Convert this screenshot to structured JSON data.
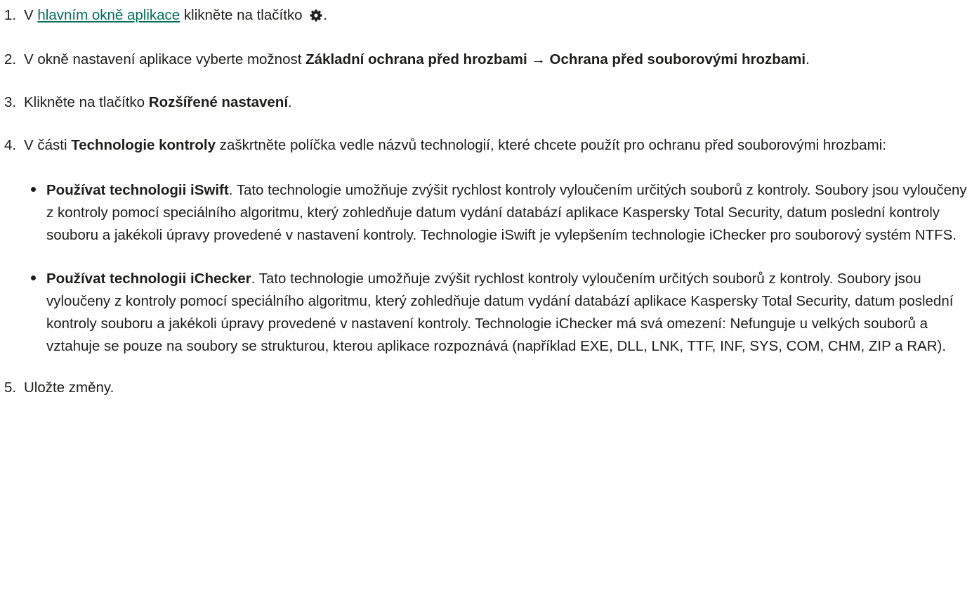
{
  "steps": [
    {
      "number": "1.",
      "prefix": "V ",
      "link": "hlavním okně aplikace",
      "middle": " klikněte na tlačítko ",
      "icon": "gear-icon",
      "suffix": "."
    },
    {
      "number": "2.",
      "text": "V okně nastavení aplikace vyberte možnost ",
      "bold": "Základní ochrana před hrozbami → Ochrana před souborovými hrozbami",
      "suffix": "."
    },
    {
      "number": "3.",
      "text": "Klikněte na tlačítko ",
      "bold": "Rozšířené nastavení",
      "suffix": "."
    },
    {
      "number": "4.",
      "prefix": "V části ",
      "bold": "Technologie kontroly",
      "suffix": " zaškrtněte políčka vedle názvů technologií, které chcete použít pro ochranu před souborovými hrozbami:",
      "bullets": [
        {
          "bold": "Používat technologii iSwift",
          "text": ". Tato technologie umožňuje zvýšit rychlost kontroly vyloučením určitých souborů z kontroly. Soubory jsou vyloučeny z kontroly pomocí speciálního algoritmu, který zohledňuje datum vydání databází aplikace Kaspersky Total Security, datum poslední kontroly souboru a jakékoli úpravy provedené v nastavení kontroly. Technologie iSwift je vylepšením technologie iChecker pro souborový systém NTFS."
        },
        {
          "bold": "Používat technologii iChecker",
          "text": ". Tato technologie umožňuje zvýšit rychlost kontroly vyloučením určitých souborů z kontroly. Soubory jsou vyloučeny z kontroly pomocí speciálního algoritmu, který zohledňuje datum vydání databází aplikace Kaspersky Total Security, datum poslední kontroly souboru a jakékoli úpravy provedené v nastavení kontroly. Technologie iChecker má svá omezení: Nefunguje u velkých souborů a vztahuje se pouze na soubory se strukturou, kterou aplikace rozpoznává (například EXE, DLL, LNK, TTF, INF, SYS, COM, CHM, ZIP a RAR)."
        }
      ]
    },
    {
      "number": "5.",
      "text": "Uložte změny."
    }
  ]
}
